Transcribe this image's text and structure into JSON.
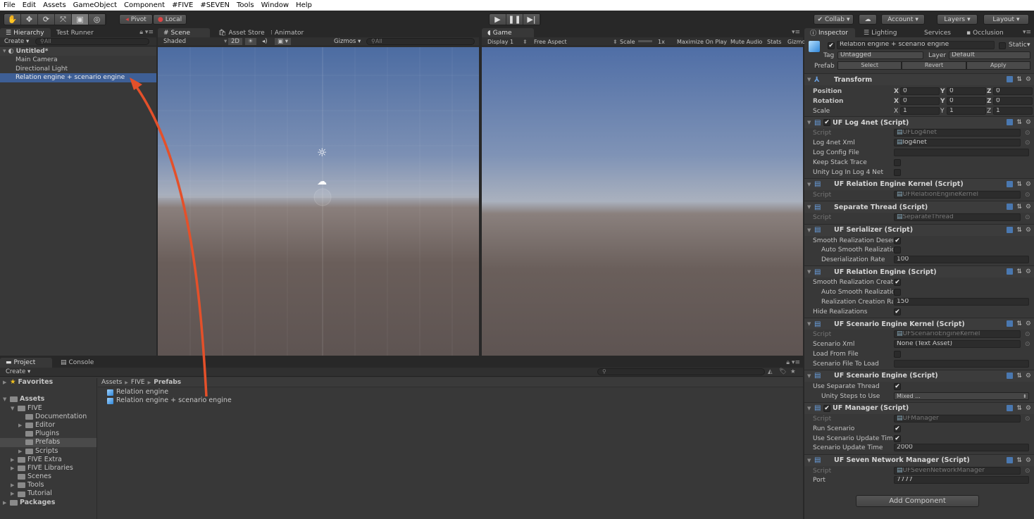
{
  "menu": [
    "File",
    "Edit",
    "Assets",
    "GameObject",
    "Component",
    "#FIVE",
    "#SEVEN",
    "Tools",
    "Window",
    "Help"
  ],
  "toolbar": {
    "pivot": "Pivot",
    "local": "Local",
    "collab": "Collab",
    "account": "Account",
    "layers": "Layers",
    "layout": "Layout"
  },
  "hierarchy": {
    "tabs": [
      "Hierarchy",
      "Test Runner"
    ],
    "create": "Create",
    "search_placeholder": "All",
    "scene": "Untitled*",
    "items": [
      "Main Camera",
      "Directional Light",
      "Relation engine + scenario engine"
    ],
    "selected": 2
  },
  "scene": {
    "tabs": [
      "Scene",
      "Asset Store",
      "Animator"
    ],
    "shading": "Shaded",
    "mode2d": "2D",
    "gizmos": "Gizmos",
    "search_placeholder": "All"
  },
  "game": {
    "tab": "Game",
    "display": "Display 1",
    "aspect": "Free Aspect",
    "scale_label": "Scale",
    "scale_value": "1x",
    "maximize": "Maximize On Play",
    "mute": "Mute Audio",
    "stats": "Stats",
    "gizmos": "Gizmo"
  },
  "inspector": {
    "tabs": [
      "Inspector",
      "Lighting",
      "Services",
      "Occlusion"
    ],
    "object_name": "Relation engine + scenario engine",
    "active": true,
    "static_label": "Static",
    "tag_label": "Tag",
    "tag": "Untagged",
    "layer_label": "Layer",
    "layer": "Default",
    "prefab_label": "Prefab",
    "prefab_buttons": [
      "Select",
      "Revert",
      "Apply"
    ],
    "transform": {
      "title": "Transform",
      "rows": [
        {
          "label": "Position",
          "x": "0",
          "y": "0",
          "z": "0"
        },
        {
          "label": "Rotation",
          "x": "0",
          "y": "0",
          "z": "0"
        },
        {
          "label": "Scale",
          "x": "1",
          "y": "1",
          "z": "1"
        }
      ]
    },
    "components": [
      {
        "title": "UF Log 4net (Script)",
        "toggle": true,
        "props": [
          {
            "label": "Script",
            "type": "text",
            "value": "UFLog4net",
            "disabled": true,
            "obj": true
          },
          {
            "label": "Log 4net Xml",
            "type": "text",
            "value": "log4net",
            "obj": true
          },
          {
            "label": "Log Config File",
            "type": "text",
            "value": ""
          },
          {
            "label": "Keep Stack Trace",
            "type": "check",
            "value": false
          },
          {
            "label": "Unity Log In Log 4 Net",
            "type": "check",
            "value": false
          }
        ]
      },
      {
        "title": "UF Relation Engine Kernel (Script)",
        "props": [
          {
            "label": "Script",
            "type": "text",
            "value": "UFRelationEngineKernel",
            "disabled": true,
            "obj": true
          }
        ]
      },
      {
        "title": "Separate Thread (Script)",
        "props": [
          {
            "label": "Script",
            "type": "text",
            "value": "SeparateThread",
            "disabled": true,
            "obj": true
          }
        ]
      },
      {
        "title": "UF Serializer (Script)",
        "props": [
          {
            "label": "Smooth Realization Deser",
            "type": "check",
            "value": true
          },
          {
            "label": "Auto Smooth Realizatio",
            "type": "check",
            "value": false,
            "indent": true
          },
          {
            "label": "Deserialization Rate",
            "type": "text",
            "value": "100",
            "indent": true
          }
        ]
      },
      {
        "title": "UF Relation Engine (Script)",
        "props": [
          {
            "label": "Smooth Realization Creati",
            "type": "check",
            "value": true
          },
          {
            "label": "Auto Smooth Realizatio",
            "type": "check",
            "value": false,
            "indent": true
          },
          {
            "label": "Realization Creation Ra",
            "type": "text",
            "value": "150",
            "indent": true
          },
          {
            "label": "Hide Realizations",
            "type": "check",
            "value": true
          }
        ]
      },
      {
        "title": "UF Scenario Engine Kernel (Script)",
        "props": [
          {
            "label": "Script",
            "type": "text",
            "value": "UFScenarioEngineKernel",
            "disabled": true,
            "obj": true
          },
          {
            "label": "Scenario Xml",
            "type": "text",
            "value": "None (Text Asset)",
            "obj": true
          },
          {
            "label": "Load From File",
            "type": "check",
            "value": false
          },
          {
            "label": "Scenario File To Load",
            "type": "text",
            "value": ""
          }
        ]
      },
      {
        "title": "UF Scenario Engine (Script)",
        "props": [
          {
            "label": "Use Separate Thread",
            "type": "check",
            "value": true
          },
          {
            "label": "Unity Steps to Use",
            "type": "select",
            "value": "Mixed ...",
            "indent": true
          }
        ]
      },
      {
        "title": "UF Manager (Script)",
        "toggle": true,
        "props": [
          {
            "label": "Script",
            "type": "text",
            "value": "UFManager",
            "disabled": true,
            "obj": true
          },
          {
            "label": "Run Scenario",
            "type": "check",
            "value": true
          },
          {
            "label": "Use Scenario Update Time",
            "type": "check",
            "value": true
          },
          {
            "label": "Scenario Update Time",
            "type": "text",
            "value": "2000"
          }
        ]
      },
      {
        "title": "UF Seven Network Manager (Script)",
        "props": [
          {
            "label": "Script",
            "type": "text",
            "value": "UFSevenNetworkManager",
            "disabled": true,
            "obj": true
          },
          {
            "label": "Port",
            "type": "text",
            "value": "7777"
          }
        ]
      }
    ],
    "add_component": "Add Component"
  },
  "project": {
    "tabs": [
      "Project",
      "Console"
    ],
    "create": "Create",
    "tree": [
      {
        "label": "Favorites",
        "depth": 0,
        "arrow": "right",
        "bold": true,
        "icon": "star"
      },
      {
        "label": "",
        "depth": 0,
        "spacer": true
      },
      {
        "label": "Assets",
        "depth": 0,
        "arrow": "down",
        "bold": true
      },
      {
        "label": "FIVE",
        "depth": 1,
        "arrow": "down"
      },
      {
        "label": "Documentation",
        "depth": 2
      },
      {
        "label": "Editor",
        "depth": 2,
        "arrow": "right"
      },
      {
        "label": "Plugins",
        "depth": 2
      },
      {
        "label": "Prefabs",
        "depth": 2,
        "selected": true
      },
      {
        "label": "Scripts",
        "depth": 2,
        "arrow": "right"
      },
      {
        "label": "FIVE Extra",
        "depth": 1,
        "arrow": "right"
      },
      {
        "label": "FIVE Libraries",
        "depth": 1,
        "arrow": "right"
      },
      {
        "label": "Scenes",
        "depth": 1
      },
      {
        "label": "Tools",
        "depth": 1,
        "arrow": "right"
      },
      {
        "label": "Tutorial",
        "depth": 1,
        "arrow": "right"
      },
      {
        "label": "Packages",
        "depth": 0,
        "arrow": "right",
        "bold": true
      }
    ],
    "breadcrumb": [
      "Assets",
      "FIVE",
      "Prefabs"
    ],
    "assets": [
      "Relation engine",
      "Relation engine + scenario engine"
    ]
  },
  "annotation_color": "#e4502a"
}
